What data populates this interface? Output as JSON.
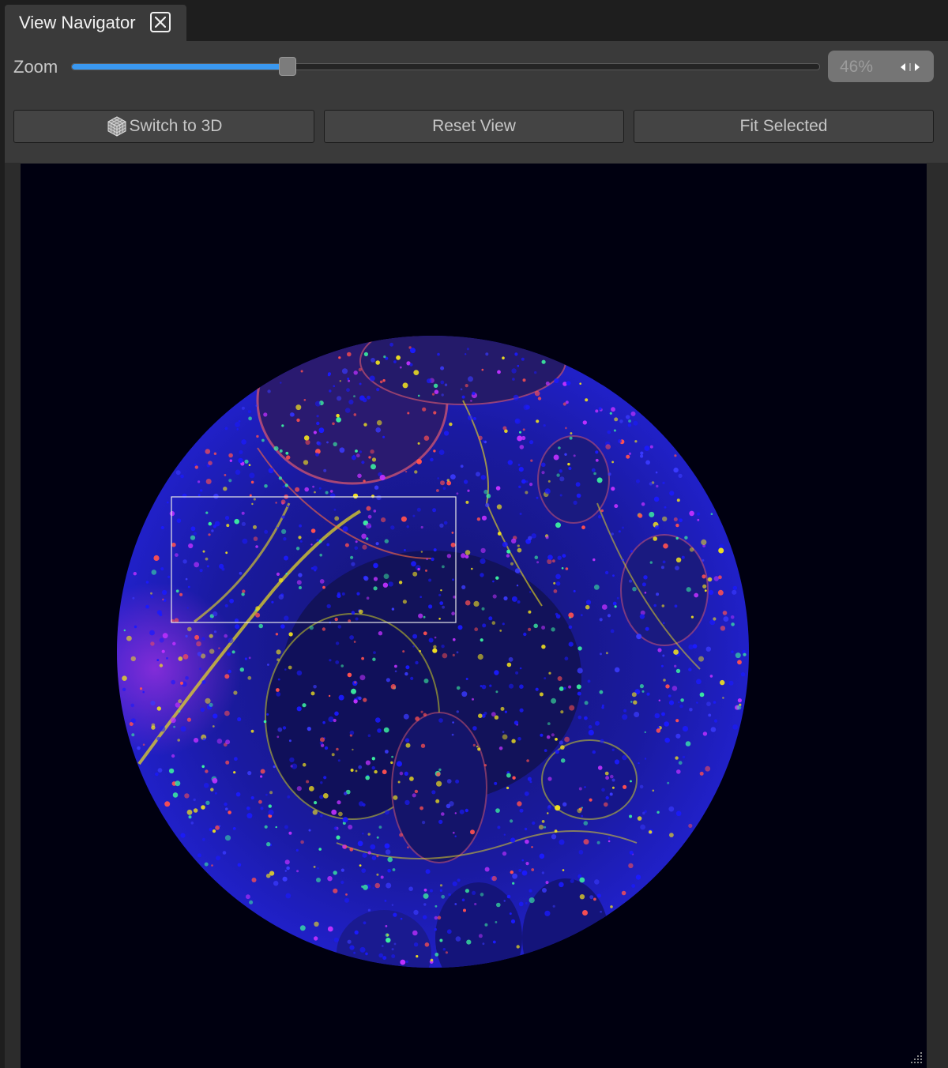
{
  "tab": {
    "title": "View Navigator",
    "close_icon": "close-icon"
  },
  "zoom": {
    "label": "Zoom",
    "value_text": "46%",
    "slider_level": 0.29
  },
  "buttons": {
    "switch_3d": "Switch to 3D",
    "reset_view": "Reset View",
    "fit_selected": "Fit Selected"
  },
  "icons": {
    "cube": "cube-icon",
    "spin": "spin-arrows-icon",
    "resize": "resize-grip-icon"
  },
  "colors": {
    "accent": "#3a98f0",
    "nuclei": "#1a1aff",
    "marker_green": "#3cf0a0",
    "marker_yellow": "#f0e020",
    "marker_red": "#ff5050",
    "marker_magenta": "#c030ff"
  }
}
